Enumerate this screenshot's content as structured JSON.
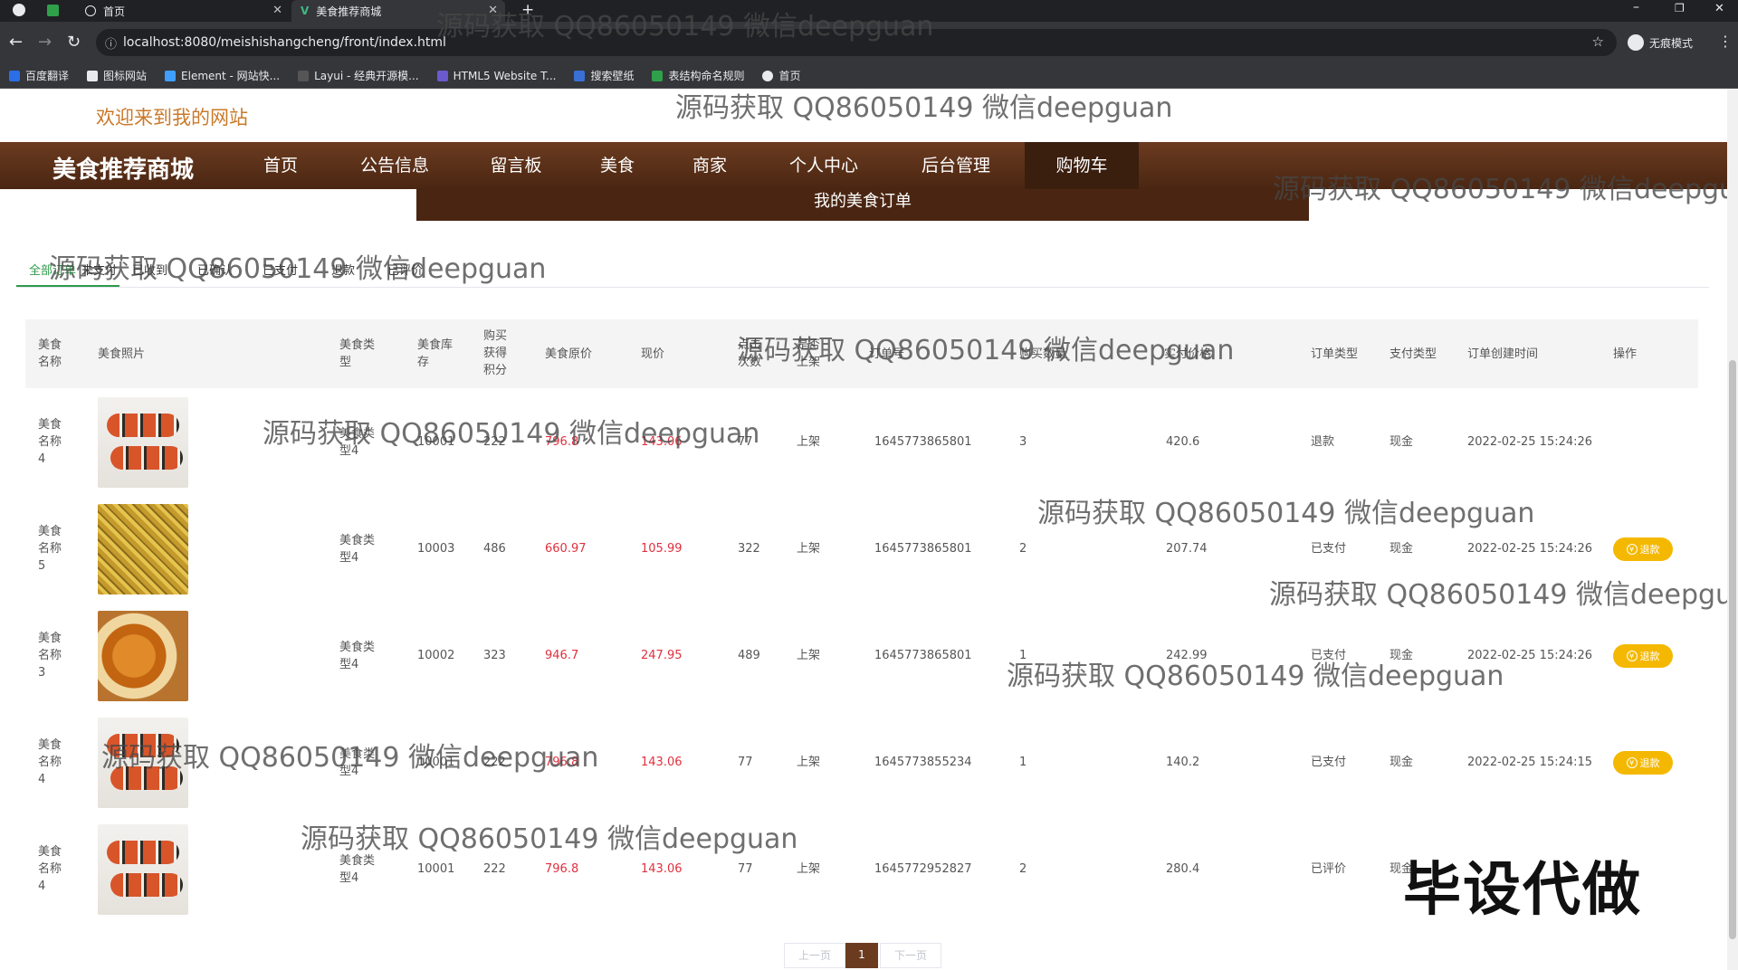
{
  "browser": {
    "tabs": [
      {
        "label": "首页"
      },
      {
        "label": "美食推荐商城"
      }
    ],
    "url": "localhost:8080/meishishangcheng/front/index.html",
    "profile": "无痕模式",
    "bookmarks": [
      "百度翻译",
      "图标网站",
      "Element - 网站快...",
      "Layui - 经典开源模...",
      "HTML5 Website T...",
      "搜索壁纸",
      "表结构命名规则",
      "首页"
    ]
  },
  "site": {
    "welcome": "欢迎来到我的网站",
    "brand": "美食推荐商城",
    "nav": [
      "首页",
      "公告信息",
      "留言板",
      "美食",
      "商家",
      "个人中心",
      "后台管理",
      "购物车"
    ],
    "active_nav": "购物车",
    "subtitle": "我的美食订单"
  },
  "order_tabs": [
    "全部订单",
    "未支付",
    "已收到",
    "已确认",
    "已支付",
    "退款",
    "已评价"
  ],
  "active_order_tab": "全部订单",
  "table": {
    "headers": {
      "name": "美食名称",
      "photo": "美食照片",
      "type": "美食类型",
      "stock": "美食库存",
      "points": "购买获得积分",
      "orig_price": "美食原价",
      "price": "现价",
      "clicks": "点击次数",
      "status": "是否上架",
      "order_no": "订单号",
      "qty": "购买数量",
      "pay_price": "实付价格",
      "order_type": "订单类型",
      "pay_type": "支付类型",
      "created": "订单创建时间",
      "action": "操作"
    },
    "rows": [
      {
        "name": "美食名称4",
        "image": "sushi",
        "type": "美食类型4",
        "stock": "10001",
        "points": "222",
        "orig_price": "796.8",
        "price": "143.06",
        "clicks": "77",
        "status": "上架",
        "order_no": "1645773865801",
        "qty": "3",
        "pay_price": "420.6",
        "order_type": "退款",
        "pay_type": "现金",
        "created": "2022-02-25 15:24:26",
        "action": ""
      },
      {
        "name": "美食名称5",
        "image": "fried",
        "type": "美食类型4",
        "stock": "10003",
        "points": "486",
        "orig_price": "660.97",
        "price": "105.99",
        "clicks": "322",
        "status": "上架",
        "order_no": "1645773865801",
        "qty": "2",
        "pay_price": "207.74",
        "order_type": "已支付",
        "pay_type": "现金",
        "created": "2022-02-25 15:24:26",
        "action": "退款"
      },
      {
        "name": "美食名称3",
        "image": "pastry",
        "type": "美食类型4",
        "stock": "10002",
        "points": "323",
        "orig_price": "946.7",
        "price": "247.95",
        "clicks": "489",
        "status": "上架",
        "order_no": "1645773865801",
        "qty": "1",
        "pay_price": "242.99",
        "order_type": "已支付",
        "pay_type": "现金",
        "created": "2022-02-25 15:24:26",
        "action": "退款"
      },
      {
        "name": "美食名称4",
        "image": "sushi",
        "type": "美食类型4",
        "stock": "10001",
        "points": "222",
        "orig_price": "796.8",
        "price": "143.06",
        "clicks": "77",
        "status": "上架",
        "order_no": "1645773855234",
        "qty": "1",
        "pay_price": "140.2",
        "order_type": "已支付",
        "pay_type": "现金",
        "created": "2022-02-25 15:24:15",
        "action": "退款"
      },
      {
        "name": "美食名称4",
        "image": "sushi",
        "type": "美食类型4",
        "stock": "10001",
        "points": "222",
        "orig_price": "796.8",
        "price": "143.06",
        "clicks": "77",
        "status": "上架",
        "order_no": "1645772952827",
        "qty": "2",
        "pay_price": "280.4",
        "order_type": "已评价",
        "pay_type": "现金",
        "created": "",
        "action": ""
      }
    ]
  },
  "pagination": {
    "prev": "上一页",
    "current": "1",
    "next": "下一页"
  },
  "watermark": "源码获取 QQ86050149 微信deepguan",
  "stamp": "毕设代做",
  "colors": {
    "nav_bg": "#4a2612",
    "accent_green": "#2f9a4a",
    "price_red": "#e0303e",
    "button_yellow": "#f5b800",
    "welcome_orange": "#c97a2a"
  }
}
